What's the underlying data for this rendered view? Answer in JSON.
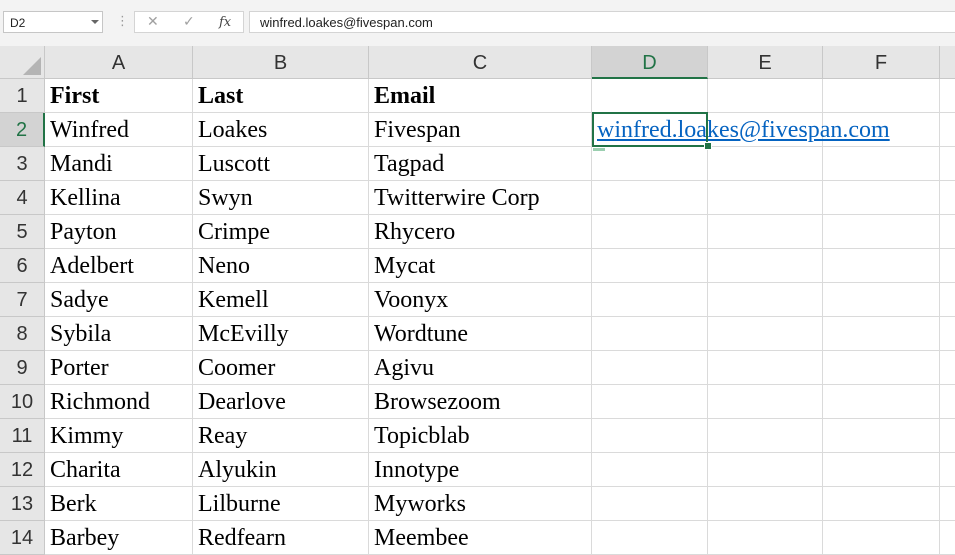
{
  "name_box": "D2",
  "formula_bar": {
    "cancel_icon": "close-icon",
    "enter_icon": "check-icon",
    "fx_label": "fx",
    "content": "winfred.loakes@fivespan.com"
  },
  "columns": [
    "A",
    "B",
    "C",
    "D",
    "E",
    "F"
  ],
  "selected_column": "D",
  "selected_row": "2",
  "rows": [
    {
      "num": "1",
      "cells": [
        "First",
        "Last",
        "Email",
        ""
      ]
    },
    {
      "num": "2",
      "cells": [
        "Winfred",
        "Loakes",
        "Fivespan",
        "winfred.loakes@fivespan.com"
      ]
    },
    {
      "num": "3",
      "cells": [
        "Mandi",
        "Luscott",
        "Tagpad",
        ""
      ]
    },
    {
      "num": "4",
      "cells": [
        "Kellina",
        "Swyn",
        "Twitterwire Corp",
        ""
      ]
    },
    {
      "num": "5",
      "cells": [
        "Payton",
        "Crimpe",
        "Rhycero",
        ""
      ]
    },
    {
      "num": "6",
      "cells": [
        "Adelbert",
        "Neno",
        "Mycat",
        ""
      ]
    },
    {
      "num": "7",
      "cells": [
        "Sadye",
        "Kemell",
        "Voonyx",
        ""
      ]
    },
    {
      "num": "8",
      "cells": [
        "Sybila",
        "McEvilly",
        "Wordtune",
        ""
      ]
    },
    {
      "num": "9",
      "cells": [
        "Porter",
        "Coomer",
        "Agivu",
        ""
      ]
    },
    {
      "num": "10",
      "cells": [
        "Richmond",
        "Dearlove",
        "Browsezoom",
        ""
      ]
    },
    {
      "num": "11",
      "cells": [
        "Kimmy",
        "Reay",
        "Topicblab",
        ""
      ]
    },
    {
      "num": "12",
      "cells": [
        "Charita",
        "Alyukin",
        "Innotype",
        ""
      ]
    },
    {
      "num": "13",
      "cells": [
        "Berk",
        "Lilburne",
        "Myworks",
        ""
      ]
    },
    {
      "num": "14",
      "cells": [
        "Barbey",
        "Redfearn",
        "Meembee",
        ""
      ]
    }
  ],
  "accent_color": "#217346",
  "link_color": "#0563c1"
}
